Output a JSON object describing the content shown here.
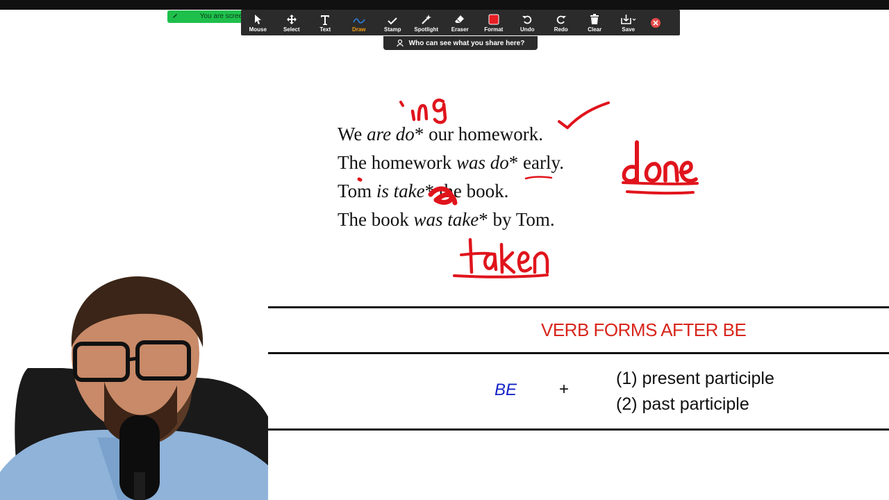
{
  "colors": {
    "accent_red": "#d8261c",
    "be_blue": "#1522c8",
    "ink_red": "#e0141c",
    "toolbar_bg": "#2b2b2b",
    "share_green": "#1fbf4c"
  },
  "share_indicator": {
    "label": "You are scree"
  },
  "toolbar": {
    "tools": [
      {
        "label": "Mouse",
        "icon": "cursor-arrow-icon"
      },
      {
        "label": "Select",
        "icon": "move-arrows-icon"
      },
      {
        "label": "Text",
        "icon": "text-t-icon"
      },
      {
        "label": "Draw",
        "icon": "pen-squiggle-icon"
      },
      {
        "label": "Stamp",
        "icon": "checkmark-icon"
      },
      {
        "label": "Spotlight",
        "icon": "magic-wand-icon"
      },
      {
        "label": "Eraser",
        "icon": "eraser-icon"
      },
      {
        "label": "Format",
        "icon": "color-square-icon"
      },
      {
        "label": "Undo",
        "icon": "undo-icon"
      },
      {
        "label": "Redo",
        "icon": "redo-icon"
      },
      {
        "label": "Clear",
        "icon": "trash-icon"
      },
      {
        "label": "Save",
        "icon": "save-download-icon"
      }
    ],
    "active_tool": "Draw"
  },
  "share_banner": {
    "label": "Who can see what you share here?"
  },
  "sentences": [
    {
      "parts": [
        "We ",
        "are do",
        "* our homework."
      ]
    },
    {
      "parts": [
        "The homework ",
        "was do",
        "* early."
      ]
    },
    {
      "parts": [
        "Tom ",
        "is take",
        "* the book."
      ]
    },
    {
      "parts": [
        "The book ",
        "was take",
        "* by Tom."
      ]
    }
  ],
  "section": {
    "heading": "VERB FORMS AFTER BE",
    "be": "BE",
    "plus": "+",
    "options": [
      "(1)  present participle",
      "(2)  past participle"
    ]
  }
}
